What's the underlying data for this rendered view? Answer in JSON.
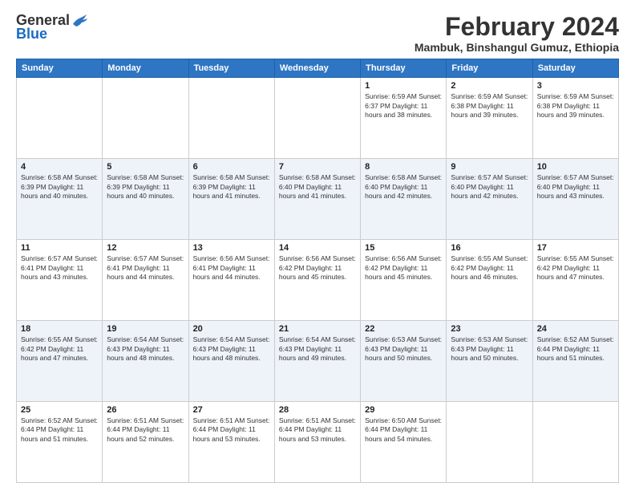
{
  "logo": {
    "general": "General",
    "blue": "Blue"
  },
  "title": "February 2024",
  "subtitle": "Mambuk, Binshangul Gumuz, Ethiopia",
  "days_of_week": [
    "Sunday",
    "Monday",
    "Tuesday",
    "Wednesday",
    "Thursday",
    "Friday",
    "Saturday"
  ],
  "weeks": [
    [
      {
        "day": "",
        "info": ""
      },
      {
        "day": "",
        "info": ""
      },
      {
        "day": "",
        "info": ""
      },
      {
        "day": "",
        "info": ""
      },
      {
        "day": "1",
        "info": "Sunrise: 6:59 AM\nSunset: 6:37 PM\nDaylight: 11 hours and 38 minutes."
      },
      {
        "day": "2",
        "info": "Sunrise: 6:59 AM\nSunset: 6:38 PM\nDaylight: 11 hours and 39 minutes."
      },
      {
        "day": "3",
        "info": "Sunrise: 6:59 AM\nSunset: 6:38 PM\nDaylight: 11 hours and 39 minutes."
      }
    ],
    [
      {
        "day": "4",
        "info": "Sunrise: 6:58 AM\nSunset: 6:39 PM\nDaylight: 11 hours and 40 minutes."
      },
      {
        "day": "5",
        "info": "Sunrise: 6:58 AM\nSunset: 6:39 PM\nDaylight: 11 hours and 40 minutes."
      },
      {
        "day": "6",
        "info": "Sunrise: 6:58 AM\nSunset: 6:39 PM\nDaylight: 11 hours and 41 minutes."
      },
      {
        "day": "7",
        "info": "Sunrise: 6:58 AM\nSunset: 6:40 PM\nDaylight: 11 hours and 41 minutes."
      },
      {
        "day": "8",
        "info": "Sunrise: 6:58 AM\nSunset: 6:40 PM\nDaylight: 11 hours and 42 minutes."
      },
      {
        "day": "9",
        "info": "Sunrise: 6:57 AM\nSunset: 6:40 PM\nDaylight: 11 hours and 42 minutes."
      },
      {
        "day": "10",
        "info": "Sunrise: 6:57 AM\nSunset: 6:40 PM\nDaylight: 11 hours and 43 minutes."
      }
    ],
    [
      {
        "day": "11",
        "info": "Sunrise: 6:57 AM\nSunset: 6:41 PM\nDaylight: 11 hours and 43 minutes."
      },
      {
        "day": "12",
        "info": "Sunrise: 6:57 AM\nSunset: 6:41 PM\nDaylight: 11 hours and 44 minutes."
      },
      {
        "day": "13",
        "info": "Sunrise: 6:56 AM\nSunset: 6:41 PM\nDaylight: 11 hours and 44 minutes."
      },
      {
        "day": "14",
        "info": "Sunrise: 6:56 AM\nSunset: 6:42 PM\nDaylight: 11 hours and 45 minutes."
      },
      {
        "day": "15",
        "info": "Sunrise: 6:56 AM\nSunset: 6:42 PM\nDaylight: 11 hours and 45 minutes."
      },
      {
        "day": "16",
        "info": "Sunrise: 6:55 AM\nSunset: 6:42 PM\nDaylight: 11 hours and 46 minutes."
      },
      {
        "day": "17",
        "info": "Sunrise: 6:55 AM\nSunset: 6:42 PM\nDaylight: 11 hours and 47 minutes."
      }
    ],
    [
      {
        "day": "18",
        "info": "Sunrise: 6:55 AM\nSunset: 6:42 PM\nDaylight: 11 hours and 47 minutes."
      },
      {
        "day": "19",
        "info": "Sunrise: 6:54 AM\nSunset: 6:43 PM\nDaylight: 11 hours and 48 minutes."
      },
      {
        "day": "20",
        "info": "Sunrise: 6:54 AM\nSunset: 6:43 PM\nDaylight: 11 hours and 48 minutes."
      },
      {
        "day": "21",
        "info": "Sunrise: 6:54 AM\nSunset: 6:43 PM\nDaylight: 11 hours and 49 minutes."
      },
      {
        "day": "22",
        "info": "Sunrise: 6:53 AM\nSunset: 6:43 PM\nDaylight: 11 hours and 50 minutes."
      },
      {
        "day": "23",
        "info": "Sunrise: 6:53 AM\nSunset: 6:43 PM\nDaylight: 11 hours and 50 minutes."
      },
      {
        "day": "24",
        "info": "Sunrise: 6:52 AM\nSunset: 6:44 PM\nDaylight: 11 hours and 51 minutes."
      }
    ],
    [
      {
        "day": "25",
        "info": "Sunrise: 6:52 AM\nSunset: 6:44 PM\nDaylight: 11 hours and 51 minutes."
      },
      {
        "day": "26",
        "info": "Sunrise: 6:51 AM\nSunset: 6:44 PM\nDaylight: 11 hours and 52 minutes."
      },
      {
        "day": "27",
        "info": "Sunrise: 6:51 AM\nSunset: 6:44 PM\nDaylight: 11 hours and 53 minutes."
      },
      {
        "day": "28",
        "info": "Sunrise: 6:51 AM\nSunset: 6:44 PM\nDaylight: 11 hours and 53 minutes."
      },
      {
        "day": "29",
        "info": "Sunrise: 6:50 AM\nSunset: 6:44 PM\nDaylight: 11 hours and 54 minutes."
      },
      {
        "day": "",
        "info": ""
      },
      {
        "day": "",
        "info": ""
      }
    ]
  ]
}
